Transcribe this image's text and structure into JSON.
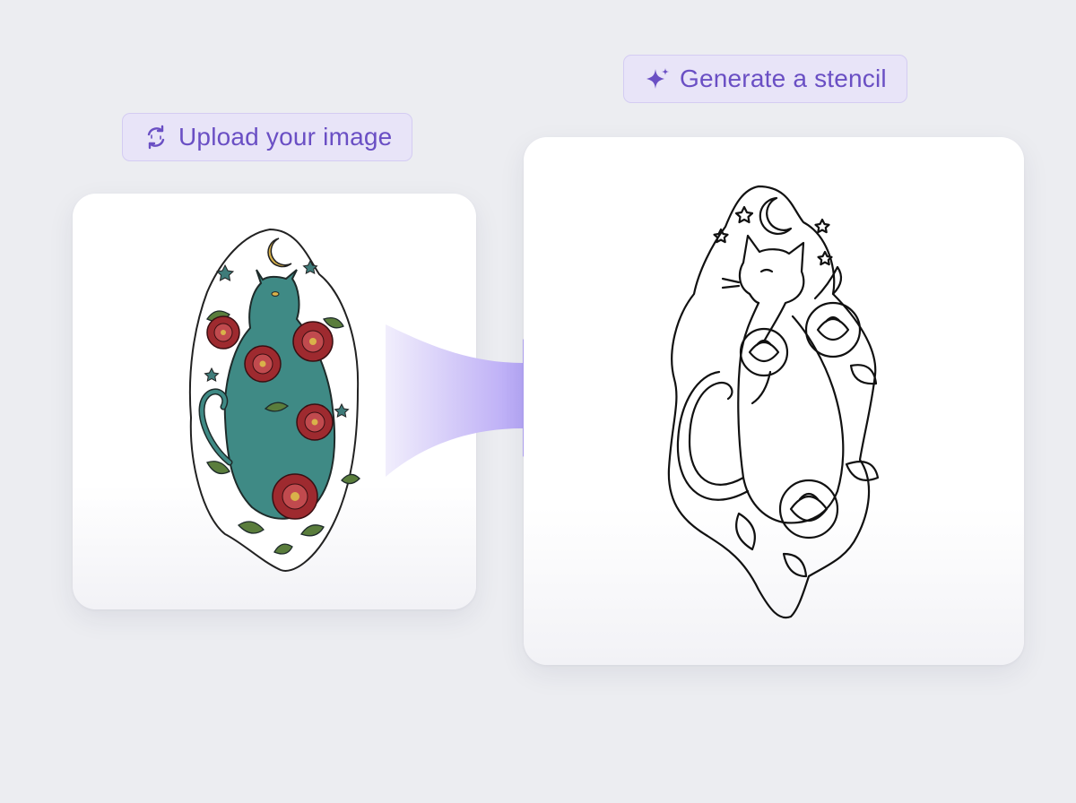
{
  "upload": {
    "label": "Upload your image",
    "icon": "refresh-arrows-icon"
  },
  "generate": {
    "label": "Generate a stencil",
    "icon": "sparkle-icon"
  },
  "source_image": {
    "subject": "cat-tattoo-color-illustration",
    "icon": "image-preview"
  },
  "stencil_image": {
    "subject": "cat-tattoo-line-stencil",
    "icon": "image-preview"
  },
  "colors": {
    "background": "#ecedf1",
    "accent": "#6a4fc4",
    "pill_bg": "#e8e4f8",
    "arrow": "#9f8ef5",
    "cat_teal": "#3f8a85",
    "peony_red": "#9e2a2f",
    "leaf_green": "#5a7d3c"
  }
}
